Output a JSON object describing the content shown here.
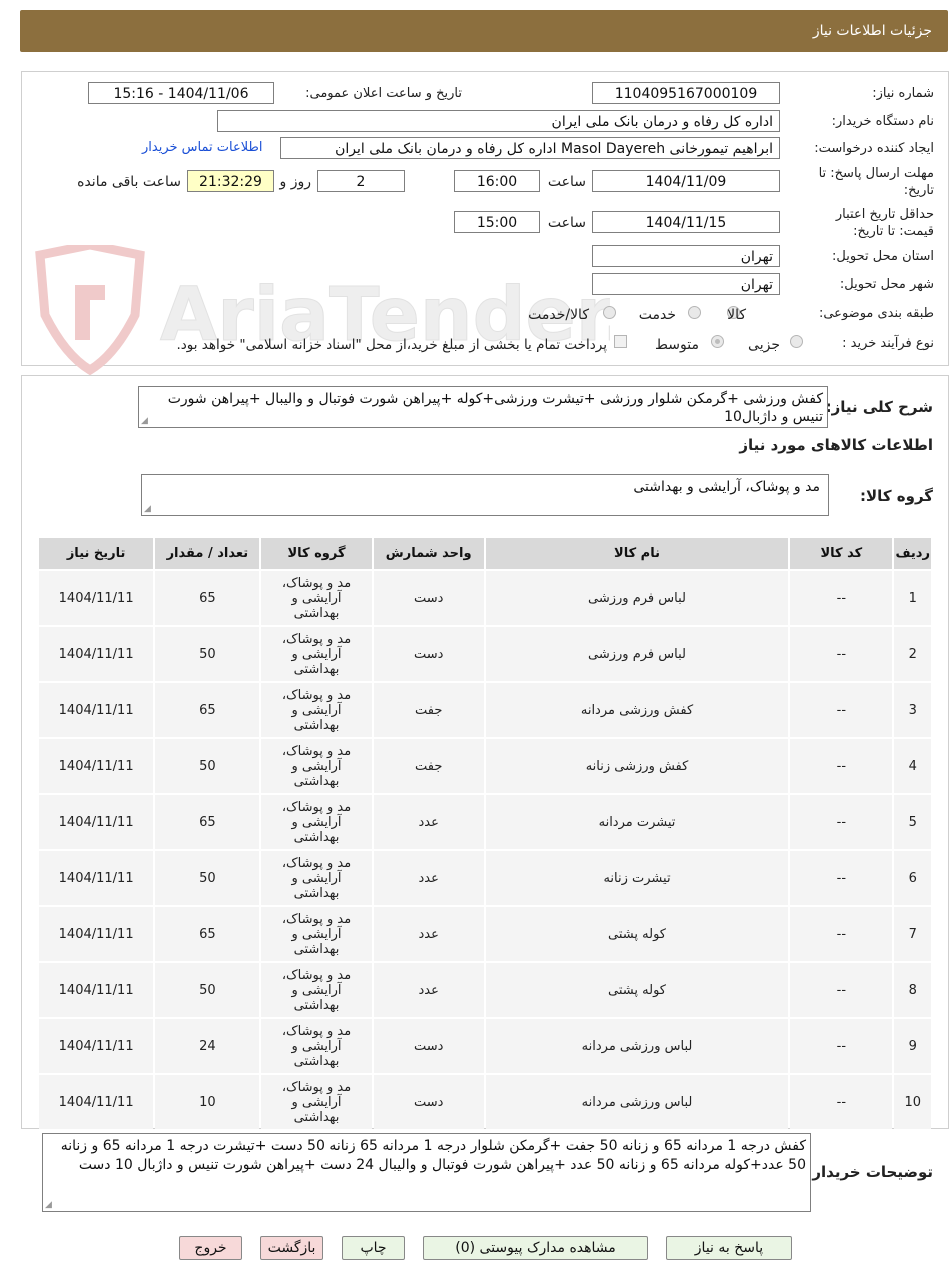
{
  "header": {
    "title": "جزئیات اطلاعات نیاز"
  },
  "watermark": {
    "text": "AriaTender.neT"
  },
  "form": {
    "need_number_label": "شماره نیاز:",
    "need_number": "1104095167000109",
    "announce_label": "تاریخ و ساعت اعلان عمومی:",
    "announce_value": "1404/11/06 - 15:16",
    "buyer_org_label": "نام دستگاه خریدار:",
    "buyer_org": "اداره کل رفاه و درمان بانک ملی ایران",
    "requester_label": "ایجاد کننده درخواست:",
    "requester": "ابراهیم تیمورخانی Masol Dayereh اداره کل رفاه و درمان بانک ملی ایران",
    "contact_link": "اطلاعات تماس خریدار",
    "deadline_label": "مهلت ارسال پاسخ: تا تاریخ:",
    "deadline_date": "1404/11/09",
    "time_label": "ساعت",
    "deadline_time": "16:00",
    "days_value": "2",
    "days_label": "روز و",
    "remaining_time": "21:32:29",
    "remaining_label": "ساعت باقی مانده",
    "validity_label": "حداقل تاریخ اعتبار قیمت: تا تاریخ:",
    "validity_date": "1404/11/15",
    "validity_time": "15:00",
    "province_label": "استان محل تحویل:",
    "province": "تهران",
    "city_label": "شهر محل تحویل:",
    "city": "تهران",
    "category_label": "طبقه بندی موضوعی:",
    "category_options": [
      "کالا",
      "خدمت",
      "کالا/خدمت"
    ],
    "process_label": "نوع فرآیند خرید :",
    "process_options": [
      "جزیی",
      "متوسط"
    ],
    "payment_note": "پرداخت تمام یا بخشی از مبلغ خرید،از محل \"اسناد خزانه اسلامی\" خواهد بود."
  },
  "summary": {
    "label": "شرح کلی نیاز:",
    "text": "کفش ورزشی +گرمکن شلوار ورزشی +تیشرت ورزشی+کوله  +پیراهن شورت فوتبال و والیبال +پیراهن شورت تنیس و داژبال10"
  },
  "goods": {
    "title": "اطلاعات کالاهای مورد نیاز",
    "group_label": "گروه کالا:",
    "group_value": "مد و پوشاک، آرایشی و بهداشتی"
  },
  "table": {
    "headers": [
      "ردیف",
      "کد کالا",
      "نام کالا",
      "واحد شمارش",
      "گروه کالا",
      "تعداد / مقدار",
      "تاریخ نیاز"
    ],
    "rows": [
      {
        "n": "1",
        "code": "--",
        "name": "لباس فرم ورزشی",
        "unit": "دست",
        "g1": "مد و پوشاک،",
        "g2": "آرایشی و",
        "g3": "بهداشتی",
        "qty": "65",
        "date": "1404/11/11"
      },
      {
        "n": "2",
        "code": "--",
        "name": "لباس فرم ورزشی",
        "unit": "دست",
        "g1": "مد و پوشاک،",
        "g2": "آرایشی و",
        "g3": "بهداشتی",
        "qty": "50",
        "date": "1404/11/11"
      },
      {
        "n": "3",
        "code": "--",
        "name": "کفش ورزشی مردانه",
        "unit": "جفت",
        "g1": "مد و پوشاک،",
        "g2": "آرایشی و",
        "g3": "بهداشتی",
        "qty": "65",
        "date": "1404/11/11"
      },
      {
        "n": "4",
        "code": "--",
        "name": "کفش ورزشی زنانه",
        "unit": "جفت",
        "g1": "مد و پوشاک،",
        "g2": "آرایشی و",
        "g3": "بهداشتی",
        "qty": "50",
        "date": "1404/11/11"
      },
      {
        "n": "5",
        "code": "--",
        "name": "تیشرت مردانه",
        "unit": "عدد",
        "g1": "مد و پوشاک،",
        "g2": "آرایشی و",
        "g3": "بهداشتی",
        "qty": "65",
        "date": "1404/11/11"
      },
      {
        "n": "6",
        "code": "--",
        "name": "تیشرت زنانه",
        "unit": "عدد",
        "g1": "مد و پوشاک،",
        "g2": "آرایشی و",
        "g3": "بهداشتی",
        "qty": "50",
        "date": "1404/11/11"
      },
      {
        "n": "7",
        "code": "--",
        "name": "کوله پشتی",
        "unit": "عدد",
        "g1": "مد و پوشاک،",
        "g2": "آرایشی و",
        "g3": "بهداشتی",
        "qty": "65",
        "date": "1404/11/11"
      },
      {
        "n": "8",
        "code": "--",
        "name": "کوله پشتی",
        "unit": "عدد",
        "g1": "مد و پوشاک،",
        "g2": "آرایشی و",
        "g3": "بهداشتی",
        "qty": "50",
        "date": "1404/11/11"
      },
      {
        "n": "9",
        "code": "--",
        "name": "لباس ورزشی مردانه",
        "unit": "دست",
        "g1": "مد و پوشاک،",
        "g2": "آرایشی و",
        "g3": "بهداشتی",
        "qty": "24",
        "date": "1404/11/11"
      },
      {
        "n": "10",
        "code": "--",
        "name": "لباس ورزشی مردانه",
        "unit": "دست",
        "g1": "مد و پوشاک،",
        "g2": "آرایشی و",
        "g3": "بهداشتی",
        "qty": "10",
        "date": "1404/11/11"
      }
    ]
  },
  "buyer_notes": {
    "label": "توضیحات خریدار:",
    "text": "کفش درجه 1 مردانه 65 و زنانه 50 جفت +گرمکن شلوار درجه 1 مردانه 65 زنانه 50 دست +تیشرت درجه 1 مردانه 65 و زنانه 50 عدد+کوله مردانه 65 و زنانه 50 عدد +پیراهن شورت فوتبال و والیبال 24 دست +پیراهن شورت تنیس و داژبال 10 دست"
  },
  "buttons": {
    "reply": "پاسخ به نیاز",
    "attachments": "مشاهده مدارک پیوستی (0)",
    "print": "چاپ",
    "back": "بازگشت",
    "exit": "خروج"
  }
}
